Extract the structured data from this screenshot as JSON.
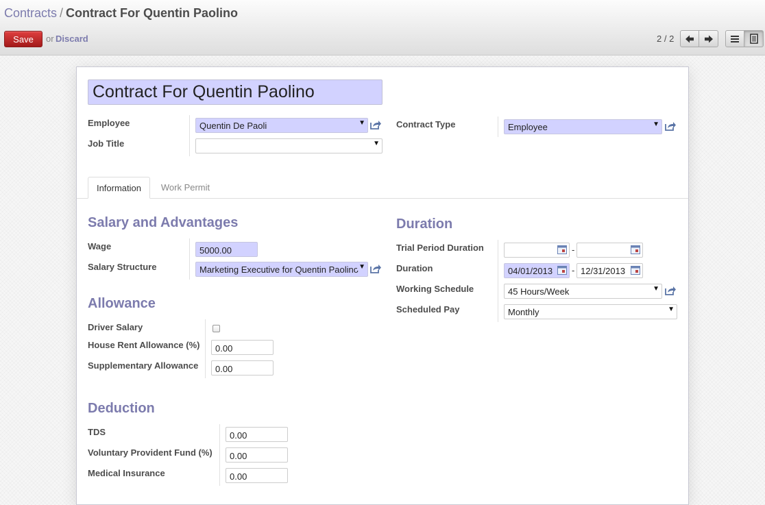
{
  "breadcrumb": {
    "parent": "Contracts",
    "separator": "/",
    "current": "Contract For Quentin Paolino"
  },
  "toolbar": {
    "save_label": "Save",
    "or_text": "or",
    "discard_label": "Discard"
  },
  "pager": {
    "value": "2 / 2"
  },
  "form": {
    "title": "Contract For Quentin Paolino",
    "employee_label": "Employee",
    "employee_value": "Quentin De Paoli",
    "job_title_label": "Job Title",
    "job_title_value": "",
    "contract_type_label": "Contract Type",
    "contract_type_value": "Employee"
  },
  "tabs": [
    {
      "label": "Information"
    },
    {
      "label": "Work Permit"
    }
  ],
  "salary": {
    "title": "Salary and Advantages",
    "wage_label": "Wage",
    "wage_value": "5000.00",
    "structure_label": "Salary Structure",
    "structure_value": "Marketing Executive for Quentin Paolino"
  },
  "allowance": {
    "title": "Allowance",
    "driver_label": "Driver Salary",
    "hra_label": "House Rent Allowance (%)",
    "hra_value": "0.00",
    "supp_label": "Supplementary Allowance",
    "supp_value": "0.00"
  },
  "deduction": {
    "title": "Deduction",
    "tds_label": "TDS",
    "tds_value": "0.00",
    "vpf_label": "Voluntary Provident Fund (%)",
    "vpf_value": "0.00",
    "medical_label": "Medical Insurance",
    "medical_value": "0.00"
  },
  "duration": {
    "title": "Duration",
    "trial_label": "Trial Period Duration",
    "trial_start": "",
    "trial_end": "",
    "duration_label": "Duration",
    "start_date": "04/01/2013",
    "end_date": "12/31/2013",
    "range_separator": "-",
    "schedule_label": "Working Schedule",
    "schedule_value": "45 Hours/Week",
    "pay_label": "Scheduled Pay",
    "pay_value": "Monthly"
  },
  "icons": {
    "prev": "arrow-left-icon",
    "next": "arrow-right-icon",
    "list_view": "list-icon",
    "form_view": "form-icon",
    "external": "external-link-icon",
    "calendar": "calendar-icon",
    "caret": "caret-down-icon"
  },
  "colors": {
    "accent": "#7c7bad",
    "required_field": "#d2d2ff",
    "save_button": "#c02828"
  }
}
